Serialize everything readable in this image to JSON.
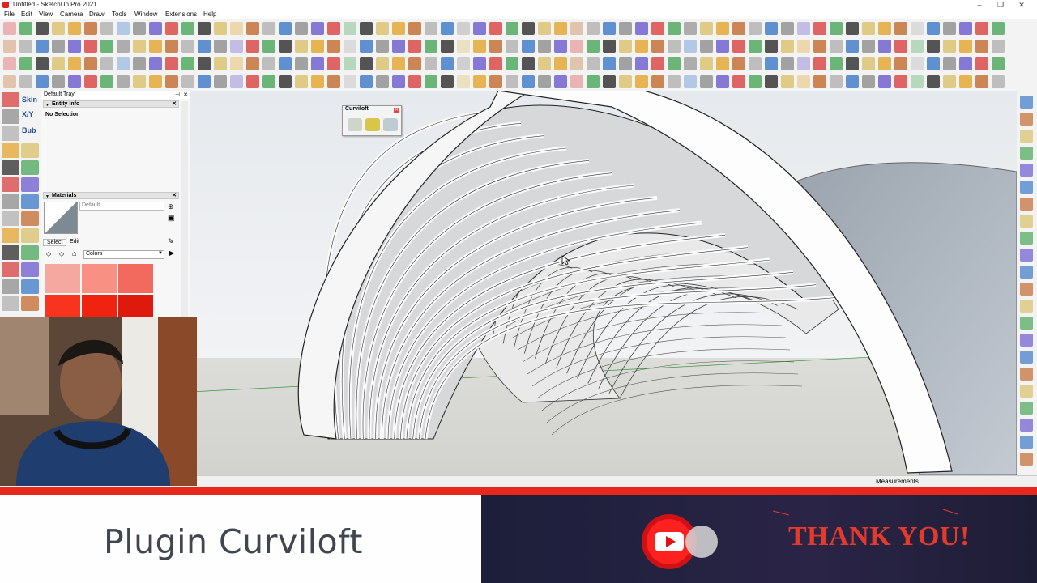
{
  "window": {
    "title": "Untitled - SketchUp Pro 2021"
  },
  "menu": [
    "File",
    "Edit",
    "View",
    "Camera",
    "Draw",
    "Tools",
    "Window",
    "Extensions",
    "Help"
  ],
  "tray": {
    "title": "Default Tray",
    "entity_info": {
      "header": "Entity Info",
      "selection": "No Selection"
    },
    "materials": {
      "header": "Materials",
      "current": "Default",
      "tabs": [
        "Select",
        "Edit"
      ],
      "library": "Colors",
      "swatches": [
        "#f4a8a0",
        "#f89183",
        "#f26a5d",
        "#f8341f",
        "#ef2310",
        "#dd1a0c"
      ]
    }
  },
  "left_tool_labels": {
    "skin": "Skin",
    "xyz": "X/Y",
    "bub": "Bub"
  },
  "curviloft_toolbar": {
    "title": "Curviloft"
  },
  "status": {
    "measurements_label": "Measurements"
  },
  "banner": {
    "title": "Plugin Curviloft",
    "thanks": "THANK YOU!"
  },
  "colors": {
    "brand_red": "#e8271d",
    "title_gray": "#404650",
    "thanks_red": "#e43a2c",
    "banner_dark": "#22223c"
  }
}
